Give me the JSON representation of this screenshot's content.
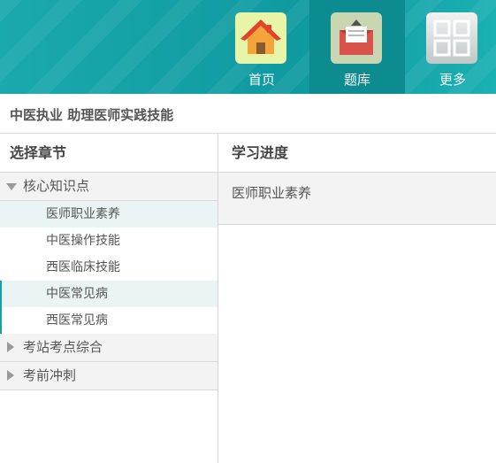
{
  "header": {
    "nav": [
      {
        "label": "首页",
        "icon": "home-icon",
        "active": false
      },
      {
        "label": "题库",
        "icon": "question-bank-icon",
        "active": true
      },
      {
        "label": "更多",
        "icon": "grid-icon",
        "active": false
      }
    ]
  },
  "breadcrumb": "中医执业 助理医师实践技能",
  "left_panel": {
    "title": "选择章节",
    "groups": [
      {
        "label": "核心知识点",
        "expanded": true,
        "items": [
          "医师职业素养",
          "中医操作技能",
          "西医临床技能",
          "中医常见病",
          "西医常见病"
        ]
      },
      {
        "label": "考站考点综合",
        "expanded": false
      },
      {
        "label": "考前冲刺",
        "expanded": false
      }
    ]
  },
  "right_panel": {
    "title": "学习进度",
    "current": "医师职业素养"
  },
  "colors": {
    "header": "#12a0a5",
    "accent": "#17a1a5"
  }
}
